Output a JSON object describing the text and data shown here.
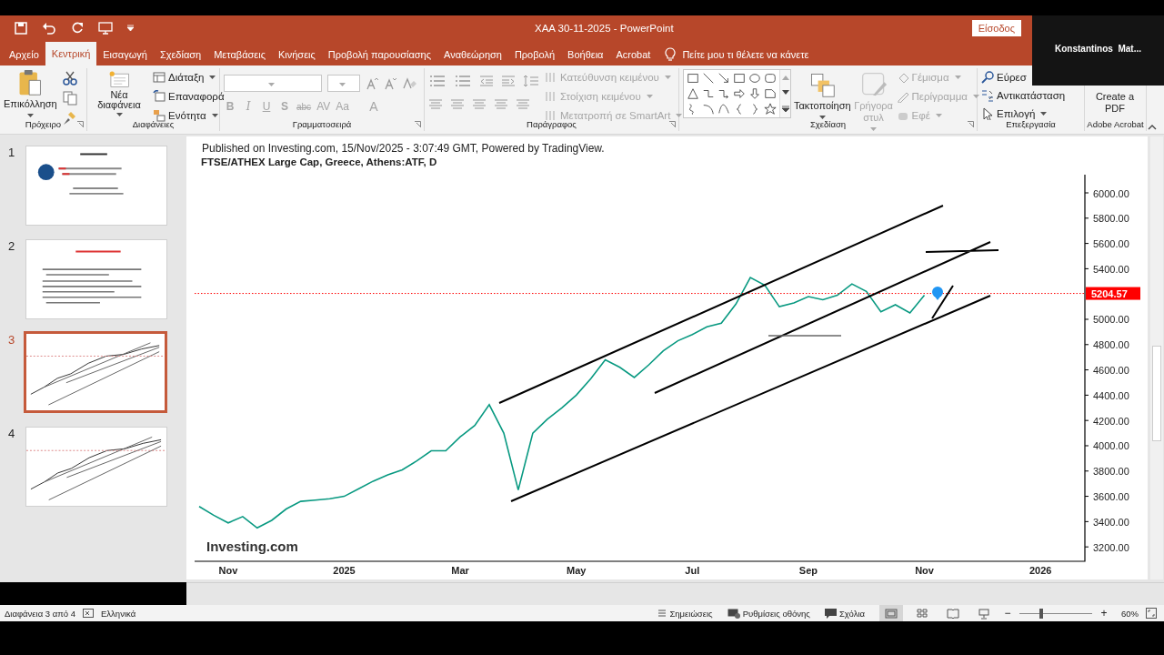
{
  "window": {
    "title": "ΧΑΑ 30-11-2025  -  PowerPoint",
    "sign_in": "Είσοδος"
  },
  "video_overlay": {
    "name": "Konstantinos  Mat..."
  },
  "tabs": [
    {
      "label": "Αρχείο",
      "selected": false
    },
    {
      "label": "Κεντρική",
      "selected": true
    },
    {
      "label": "Εισαγωγή",
      "selected": false
    },
    {
      "label": "Σχεδίαση",
      "selected": false
    },
    {
      "label": "Μεταβάσεις",
      "selected": false
    },
    {
      "label": "Κινήσεις",
      "selected": false
    },
    {
      "label": "Προβολή παρουσίασης",
      "selected": false
    },
    {
      "label": "Αναθεώρηση",
      "selected": false
    },
    {
      "label": "Προβολή",
      "selected": false
    },
    {
      "label": "Βοήθεια",
      "selected": false
    },
    {
      "label": "Acrobat",
      "selected": false
    }
  ],
  "tell_me": {
    "text": "Πείτε μου τι θέλετε να κάνετε"
  },
  "ribbon": {
    "groups": [
      {
        "kind": "clipboard",
        "label": "Πρόχειρο",
        "paste": "Επικόλληση"
      },
      {
        "kind": "slides",
        "label": "Διαφάνειες",
        "new_slide": "Νέα διαφάνεια",
        "commands": [
          {
            "label": "Διάταξη",
            "dropdown": true
          },
          {
            "label": "Επαναφορά",
            "dropdown": false
          },
          {
            "label": "Ενότητα",
            "dropdown": true
          }
        ]
      },
      {
        "kind": "font",
        "label": "Γραμματοσειρά",
        "disabled": true,
        "format_buttons": [
          "B",
          "I",
          "U",
          "S",
          "abc",
          "AV",
          "Aa",
          "A"
        ]
      },
      {
        "kind": "paragraph",
        "label": "Παράγραφος",
        "commands": [
          {
            "label": "Κατεύθυνση κειμένου",
            "disabled": true,
            "dropdown": true
          },
          {
            "label": "Στοίχιση κειμένου",
            "disabled": true,
            "dropdown": true
          },
          {
            "label": "Μετατροπή σε SmartArt",
            "disabled": true,
            "dropdown": true
          }
        ]
      },
      {
        "kind": "drawing",
        "label": "Σχεδίαση",
        "arrange": "Τακτοποίηση",
        "quick_styles": {
          "label": "Γρήγορα στυλ",
          "disabled": true
        },
        "commands": [
          {
            "label": "Γέμισμα",
            "disabled": true,
            "dropdown": true
          },
          {
            "label": "Περίγραμμα",
            "disabled": true,
            "dropdown": true
          },
          {
            "label": "Εφέ",
            "disabled": true,
            "dropdown": true
          }
        ]
      },
      {
        "kind": "editing",
        "label": "Επεξεργασία",
        "commands": [
          {
            "label": "Εύρεσ",
            "disabled": false,
            "dropdown": false
          },
          {
            "label": "Αντικατάσταση",
            "disabled": false,
            "dropdown": false
          },
          {
            "label": "Επιλογή",
            "disabled": false,
            "dropdown": true
          }
        ]
      },
      {
        "kind": "acrobat",
        "label": "Adobe Acrobat",
        "button": "Create a PDF"
      }
    ]
  },
  "slides_panel": {
    "slides": [
      {
        "number": "1",
        "selected": false
      },
      {
        "number": "2",
        "selected": false
      },
      {
        "number": "3",
        "selected": true
      },
      {
        "number": "4",
        "selected": false
      }
    ]
  },
  "slide": {
    "header": "Published on Investing.com, 15/Nov/2025 - 3:07:49 GMT, Powered by TradingView.",
    "logo": "Investing.com",
    "chart_data": {
      "type": "line",
      "title": "FTSE/ATHEX Large Cap, Greece, Athens:ATF, D",
      "categories": [
        null,
        null,
        "Nov",
        null,
        null,
        null,
        null,
        null,
        null,
        null,
        "2025",
        null,
        null,
        null,
        null,
        null,
        null,
        null,
        "Mar",
        null,
        null,
        null,
        null,
        null,
        null,
        null,
        "May",
        null,
        null,
        null,
        null,
        null,
        null,
        null,
        "Jul",
        null,
        null,
        null,
        null,
        null,
        null,
        null,
        "Sep",
        null,
        null,
        null,
        null,
        null,
        null,
        null,
        "Nov",
        null,
        null,
        null,
        null,
        null,
        null,
        null,
        "2026",
        null,
        null,
        null
      ],
      "series": [
        {
          "color": "#089981",
          "values": [
            3520,
            3450,
            3390,
            3440,
            3350,
            3410,
            3500,
            3560,
            3570,
            3580,
            3600,
            3660,
            3720,
            3770,
            3810,
            3880,
            3960,
            3960,
            4070,
            4160,
            4325,
            4100,
            3650,
            4100,
            4210,
            4300,
            4400,
            4530,
            4680,
            4620,
            4540,
            4640,
            4750,
            4830,
            4880,
            4940,
            4970,
            5120,
            5330,
            5270,
            5100,
            5130,
            5180,
            5155,
            5190,
            5280,
            5220,
            5060,
            5115,
            5050,
            5190,
            null,
            null,
            null,
            null,
            null,
            null,
            null,
            null,
            null,
            null,
            null
          ]
        }
      ],
      "ylim": [
        3086,
        6144
      ],
      "yticks": [
        {
          "value": 3200,
          "label": "3200.00"
        },
        {
          "value": 3400,
          "label": "3400.00"
        },
        {
          "value": 3600,
          "label": "3600.00"
        },
        {
          "value": 3800,
          "label": "3800.00"
        },
        {
          "value": 4000,
          "label": "4000.00"
        },
        {
          "value": 4200,
          "label": "4200.00"
        },
        {
          "value": 4400,
          "label": "4400.00"
        },
        {
          "value": 4600,
          "label": "4600.00"
        },
        {
          "value": 4800,
          "label": "4800.00"
        },
        {
          "value": 5000,
          "label": "5000.00"
        },
        {
          "value": 5400,
          "label": "5400.00"
        },
        {
          "value": 5600,
          "label": "5600.00"
        },
        {
          "value": 5800,
          "label": "5800.00"
        },
        {
          "value": 6000,
          "label": "6000.00"
        }
      ],
      "ref_lines": [
        {
          "axis": "y",
          "value": 5204.57,
          "label": "5204.57",
          "color": "#ff0000"
        }
      ]
    }
  },
  "status_bar": {
    "slide_info": "Διαφάνεια 3 από 4",
    "language": "Ελληνικά",
    "notes": "Σημειώσεις",
    "display": "Ρυθμίσεις οθόνης",
    "comments": "Σχόλια",
    "views": [
      {
        "selected": true
      },
      {
        "selected": false
      },
      {
        "selected": false
      },
      {
        "selected": false
      }
    ],
    "zoom": {
      "level": 0.3,
      "reading": "60%",
      "out_label": "−",
      "in_label": "+"
    }
  }
}
